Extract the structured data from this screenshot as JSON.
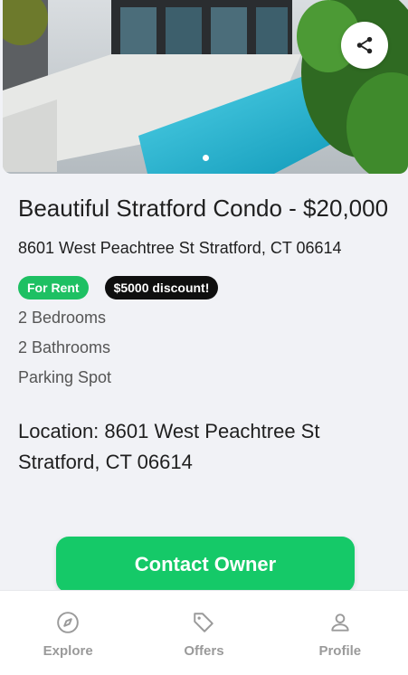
{
  "listing": {
    "title": "Beautiful Stratford Condo - $20,000",
    "address": "8601 West Peachtree St Stratford, CT 06614",
    "badges": {
      "rent": "For Rent",
      "discount": "$5000 discount!"
    },
    "features": [
      "2 Bedrooms",
      "2 Bathrooms",
      "Parking Spot"
    ],
    "location": "Location: 8601 West Peachtree St Stratford, CT 06614"
  },
  "actions": {
    "contact_label": "Contact Owner"
  },
  "tabs": {
    "explore": "Explore",
    "offers": "Offers",
    "profile": "Profile"
  },
  "icons": {
    "share": "share-icon",
    "explore": "compass-icon",
    "offers": "tag-icon",
    "profile": "person-icon"
  },
  "colors": {
    "accent": "#15c968",
    "badge_rent": "#1ec063",
    "badge_discount": "#0f0f0f",
    "tab_inactive": "#9a9a9a"
  },
  "carousel": {
    "slide_count": 1,
    "active_index": 0
  }
}
